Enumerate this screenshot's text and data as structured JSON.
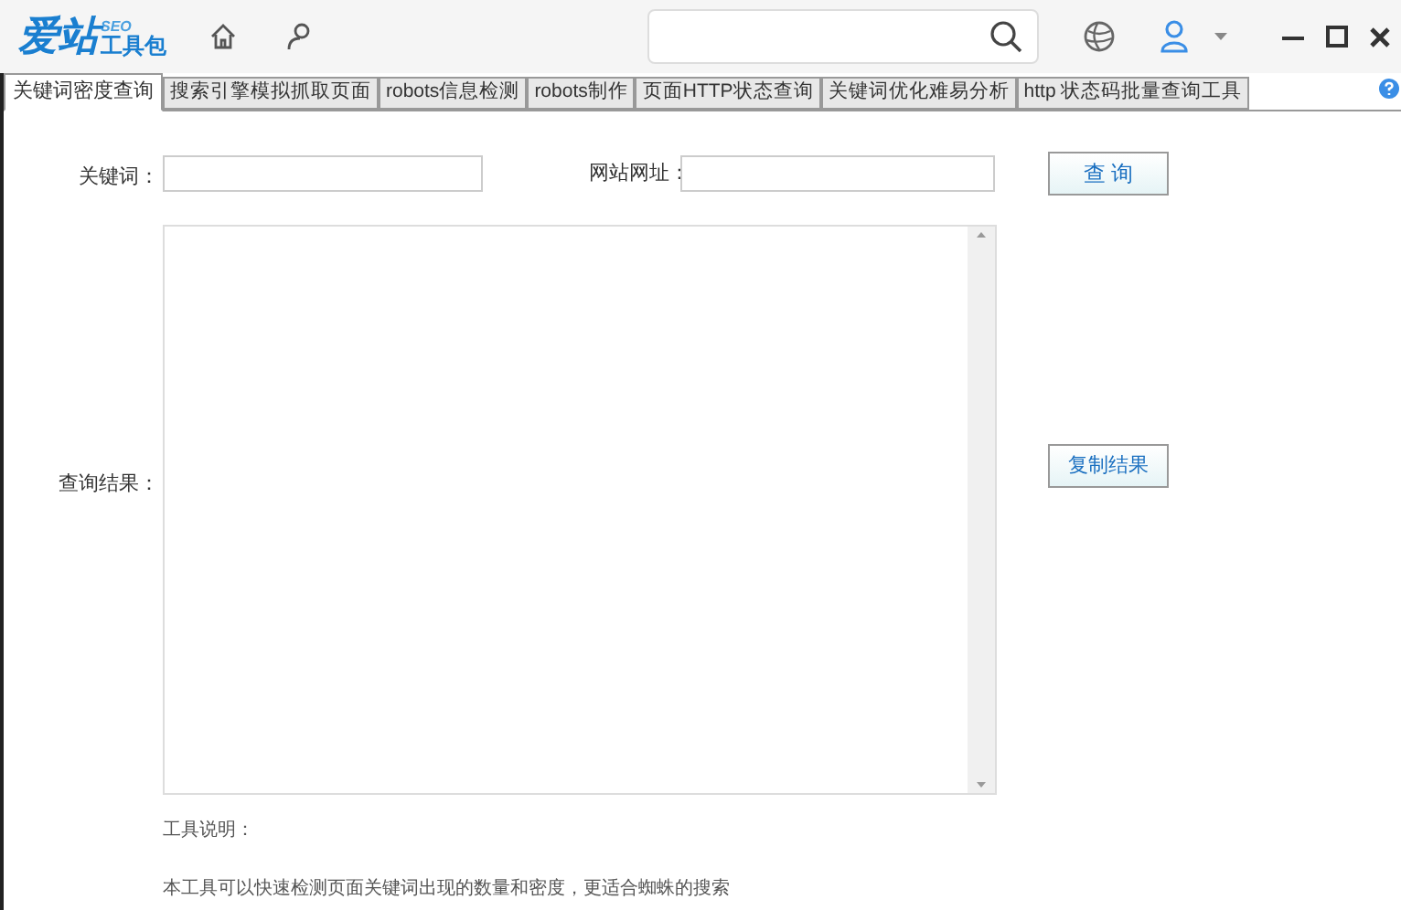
{
  "logo": {
    "main": "爱站",
    "sup": "SEO",
    "sub": "工具包"
  },
  "tabs": [
    {
      "label": "关键词密度查询",
      "selected": true
    },
    {
      "label": "搜索引擎模拟抓取页面",
      "selected": false
    },
    {
      "label": "robots信息检测",
      "selected": false
    },
    {
      "label": "robots制作",
      "selected": false
    },
    {
      "label": "页面HTTP状态查询",
      "selected": false
    },
    {
      "label": "关键词优化难易分析",
      "selected": false
    },
    {
      "label": "http 状态码批量查询工具",
      "selected": false
    }
  ],
  "form": {
    "keyword_label": "关键词：",
    "url_label": "网站网址：",
    "query_button": "查 询",
    "result_label": "查询结果：",
    "copy_button": "复制结果"
  },
  "notes": {
    "title": "工具说明：",
    "text": "本工具可以快速检测页面关键词出现的数量和密度，更适合蜘蛛的搜索"
  }
}
